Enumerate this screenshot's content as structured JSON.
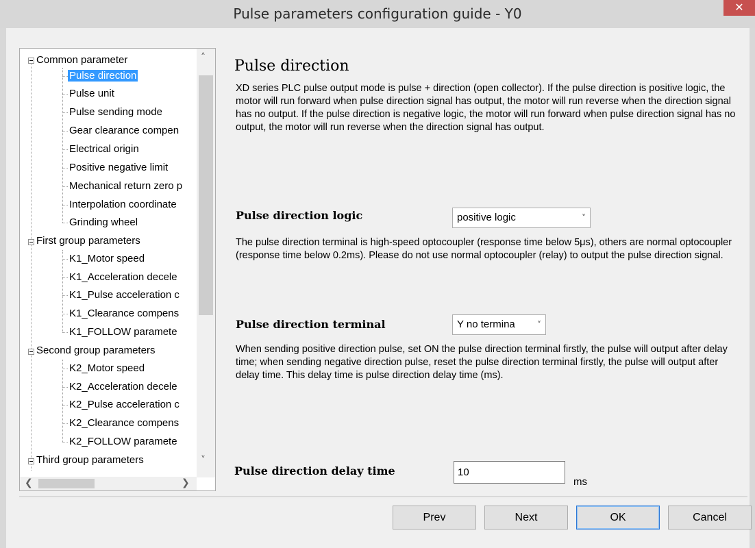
{
  "window": {
    "title": "Pulse parameters configuration guide - Y0",
    "close_glyph": "✕"
  },
  "tree": {
    "groups": [
      {
        "label": "Common parameter",
        "items": [
          "Pulse direction",
          "Pulse unit",
          "Pulse sending mode",
          "Gear clearance compen",
          "Electrical origin",
          "Positive negative limit",
          "Mechanical return zero p",
          "Interpolation coordinate",
          "Grinding wheel"
        ]
      },
      {
        "label": "First group parameters",
        "items": [
          "K1_Motor speed",
          "K1_Acceleration decele",
          "K1_Pulse acceleration c",
          "K1_Clearance compens",
          "K1_FOLLOW paramete"
        ]
      },
      {
        "label": "Second group parameters",
        "items": [
          "K2_Motor speed",
          "K2_Acceleration decele",
          "K2_Pulse acceleration c",
          "K2_Clearance compens",
          "K2_FOLLOW paramete"
        ]
      },
      {
        "label": "Third group parameters",
        "items": []
      }
    ],
    "selected": "Pulse direction",
    "scroll_glyphs": {
      "up": "˄",
      "down": "˅",
      "left": "❮",
      "right": "❯"
    }
  },
  "content": {
    "heading": "Pulse direction",
    "intro": "XD series PLC pulse output mode is pulse + direction (open collector). If the pulse direction is positive logic, the motor will run forward when pulse direction signal has output, the motor will run reverse when the direction signal has no output. If the pulse direction is negative logic, the motor will run forward when pulse direction signal has no output, the motor will run reverse when the direction signal has output.",
    "logic": {
      "label": "Pulse direction logic",
      "value": "positive logic",
      "description": "The pulse direction terminal is high-speed optocoupler (response time below 5μs), others are normal optocoupler (response time below 0.2ms). Please do not use normal optocoupler (relay) to output the pulse direction signal."
    },
    "terminal": {
      "label": "Pulse direction terminal",
      "value": "Y no termina",
      "description": "When sending positive direction pulse, set ON the pulse direction terminal firstly, the pulse will output after delay time; when sending negative direction pulse, reset the pulse direction terminal firstly, the pulse will output after delay time. This delay time is pulse direction delay time (ms)."
    },
    "delay": {
      "label": "Pulse direction delay time",
      "value": "10",
      "unit": "ms"
    },
    "chevron": "˅"
  },
  "buttons": {
    "prev": "Prev",
    "next": "Next",
    "ok": "OK",
    "cancel": "Cancel"
  }
}
